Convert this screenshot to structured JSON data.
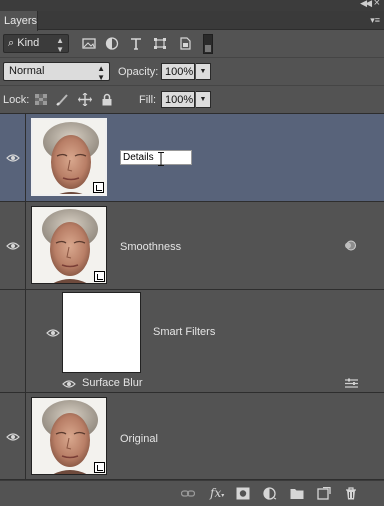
{
  "window": {
    "collapse_icon": "double-chevron-left-icon",
    "close_icon": "close-icon"
  },
  "panel": {
    "tab_label": "Layers",
    "menu_icon": "panel-menu-icon"
  },
  "filter": {
    "kind_label": "Kind",
    "icons": [
      "pixel-layer-filter-icon",
      "adjustment-layer-filter-icon",
      "type-layer-filter-icon",
      "shape-layer-filter-icon",
      "smart-object-filter-icon"
    ]
  },
  "blend": {
    "mode": "Normal",
    "opacity_label": "Opacity:",
    "opacity_value": "100%"
  },
  "lock": {
    "label": "Lock:",
    "icons": [
      "lock-transparent-pixels-icon",
      "lock-image-pixels-icon",
      "lock-position-icon",
      "lock-all-icon"
    ],
    "fill_label": "Fill:",
    "fill_value": "100%"
  },
  "layers": [
    {
      "name": "Details",
      "editing": true,
      "selected": true,
      "smart_object": true
    },
    {
      "name": "Smoothness",
      "selected": false,
      "smart_object": true,
      "has_filters": true
    },
    {
      "name": "Smart Filters",
      "type": "filter-mask"
    },
    {
      "name": "Surface Blur",
      "type": "filter"
    },
    {
      "name": "Original",
      "selected": false,
      "smart_object": true
    }
  ],
  "footer_icons": [
    "link-layers-icon",
    "fx-icon",
    "add-mask-icon",
    "new-adjustment-layer-icon",
    "new-group-icon",
    "new-layer-icon",
    "delete-layer-icon"
  ],
  "colors": {
    "panel": "#535353",
    "selected_row": "#58637a",
    "header": "#3a3a3a"
  }
}
